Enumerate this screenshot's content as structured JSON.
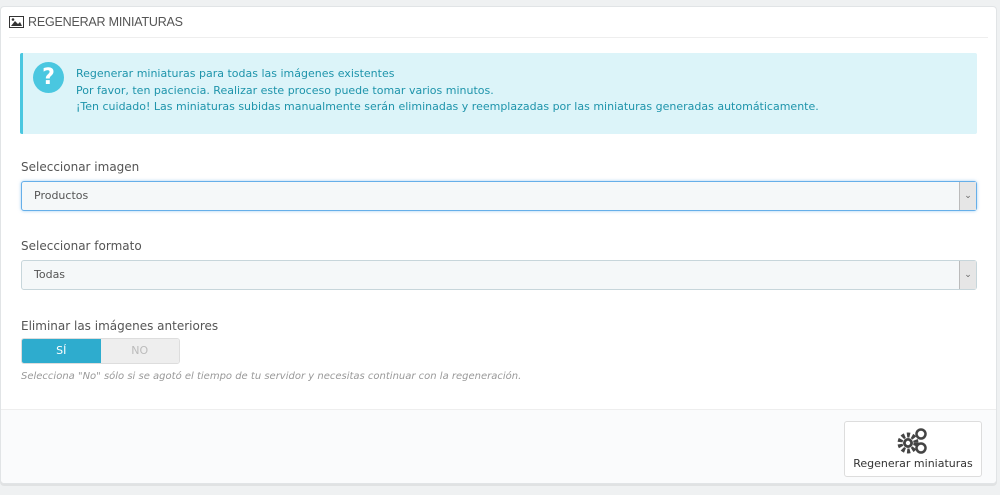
{
  "panel": {
    "title": "REGENERAR MINIATURAS"
  },
  "alert": {
    "lines": [
      "Regenerar miniaturas para todas las imágenes existentes",
      "Por favor, ten paciencia. Realizar este proceso puede tomar varios minutos.",
      "¡Ten cuidado! Las miniaturas subidas manualmente serán eliminadas y reemplazadas por las miniaturas generadas automáticamente."
    ]
  },
  "image_select": {
    "label": "Seleccionar imagen",
    "value": "Productos"
  },
  "format_select": {
    "label": "Seleccionar formato",
    "value": "Todas"
  },
  "erase": {
    "label": "Eliminar las imágenes anteriores",
    "yes": "SÍ",
    "no": "NO",
    "selected": "SÍ",
    "help": "Selecciona \"No\" sólo si se agotó el tiempo de tu servidor y necesitas continuar con la regeneración."
  },
  "footer": {
    "submit_label": "Regenerar miniaturas"
  }
}
